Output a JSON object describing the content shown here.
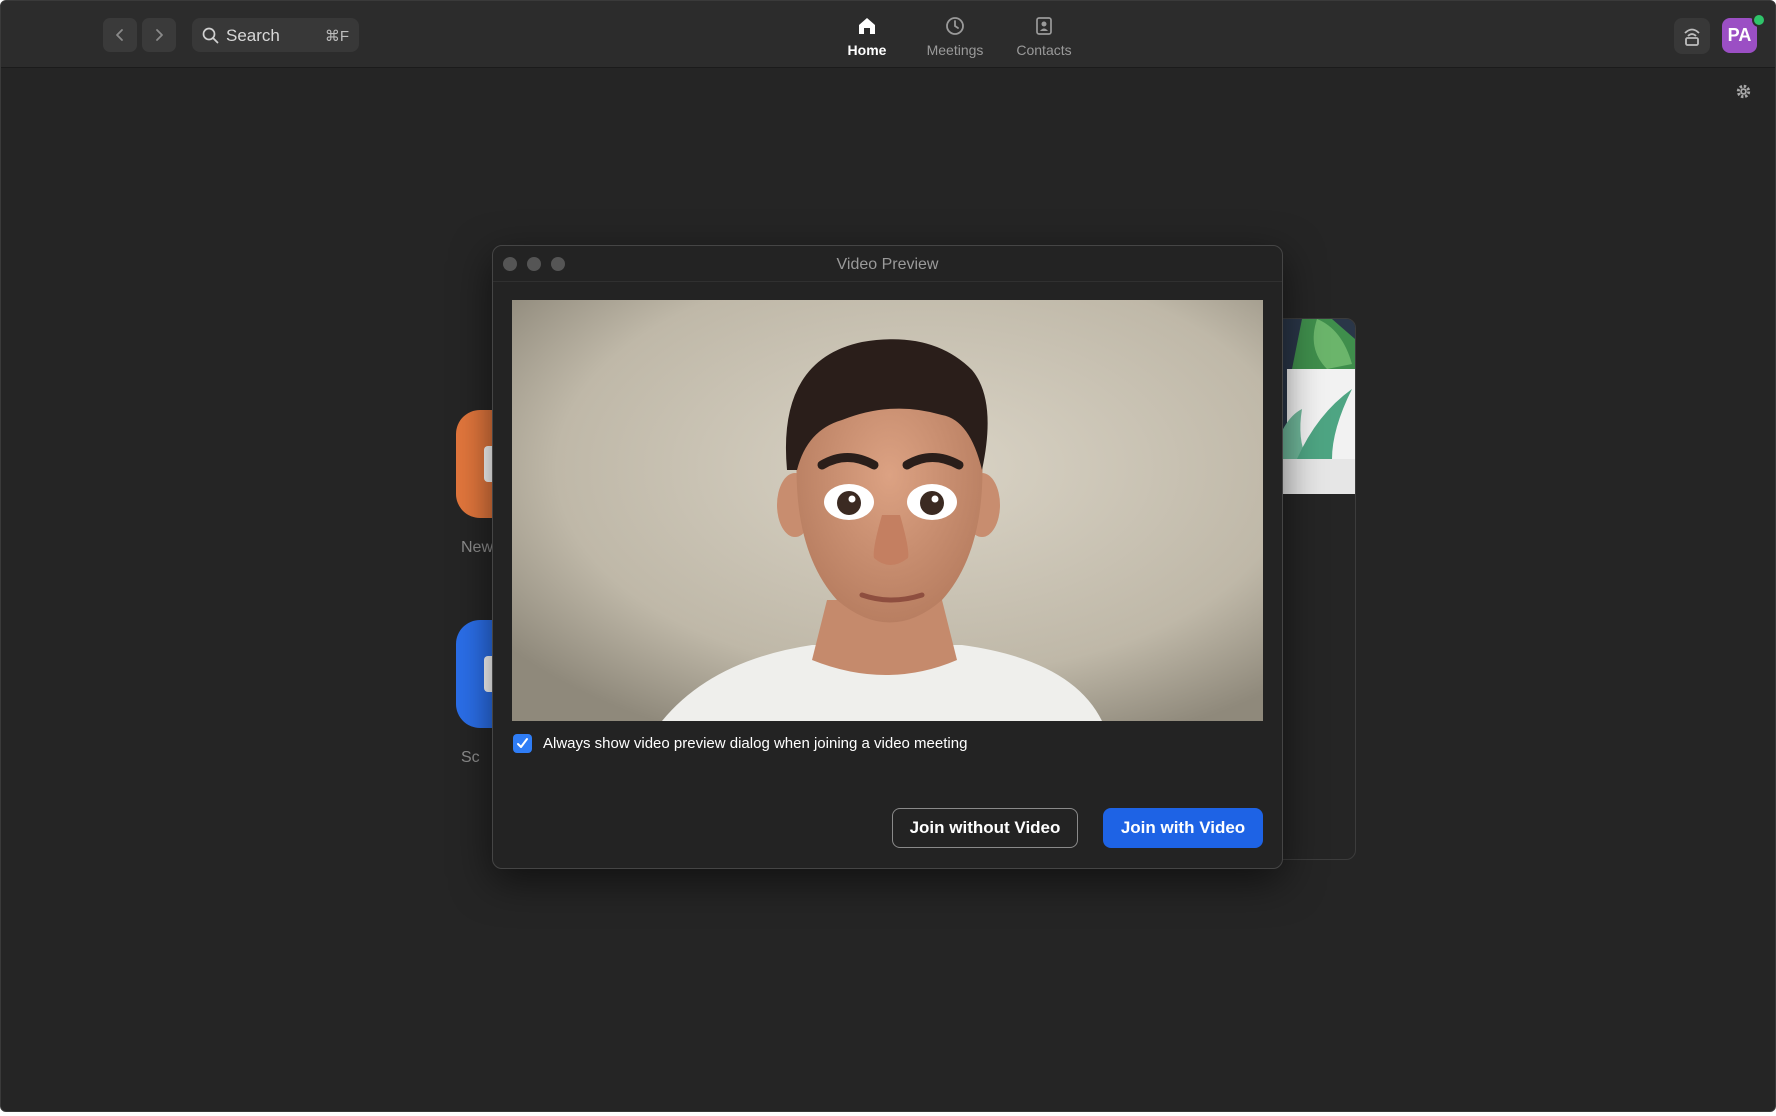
{
  "topbar": {
    "back_icon": "chevron-left-icon",
    "forward_icon": "chevron-right-icon",
    "search": {
      "label": "Search",
      "shortcut": "⌘F"
    },
    "tabs": [
      {
        "label": "Home",
        "icon": "home-icon",
        "active": true
      },
      {
        "label": "Meetings",
        "icon": "clock-icon",
        "active": false
      },
      {
        "label": "Contacts",
        "icon": "contacts-icon",
        "active": false
      }
    ],
    "avatar_initials": "PA",
    "presence_color": "#2fc46a",
    "avatar_color": "#9b4fc4"
  },
  "home": {
    "tiles": [
      {
        "label": "New",
        "color": "#e3773d"
      },
      {
        "label": "Sc",
        "color": "#2b6fea"
      }
    ]
  },
  "dialog": {
    "title": "Video Preview",
    "checkbox": {
      "label": "Always show video preview dialog when joining a video meeting",
      "checked": true
    },
    "buttons": {
      "join_without_video": "Join without Video",
      "join_with_video": "Join with Video"
    },
    "accent_color": "#1e63e5"
  }
}
